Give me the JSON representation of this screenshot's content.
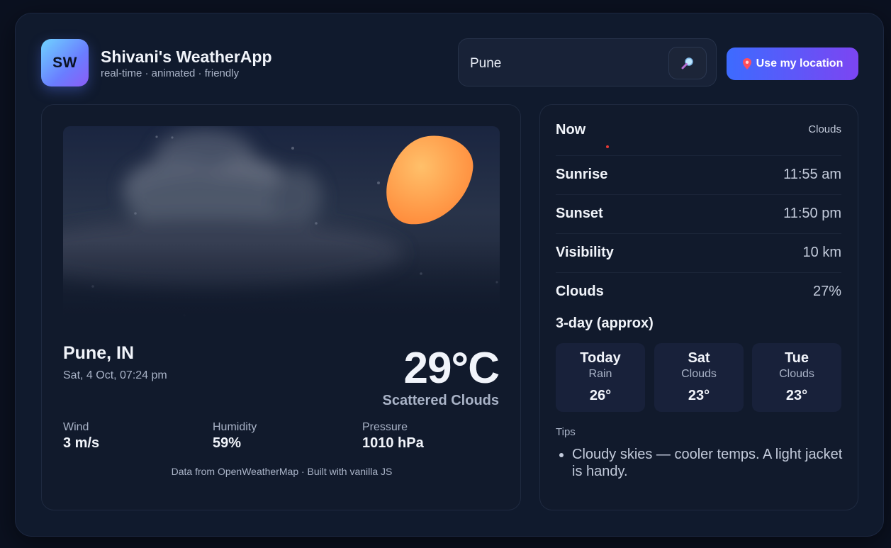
{
  "header": {
    "logo_text": "SW",
    "title": "Shivani's WeatherApp",
    "subtitle": "real-time · animated · friendly",
    "search_value": "Pune",
    "search_icon": "magnifier-icon",
    "location_icon": "pin-icon",
    "location_button": "Use my location",
    "accent_gradient": [
      "#3d6bff",
      "#7c45f2"
    ]
  },
  "current": {
    "city": "Pune, IN",
    "datetime": "Sat, 4 Oct, 07:24 pm",
    "temperature": "29°C",
    "condition": "Scattered Clouds",
    "metrics": [
      {
        "label": "Wind",
        "value": "3 m/s"
      },
      {
        "label": "Humidity",
        "value": "59%"
      },
      {
        "label": "Pressure",
        "value": "1010 hPa"
      }
    ],
    "credit": "Data from OpenWeatherMap · Built with vanilla JS"
  },
  "details": {
    "now_label": "Now",
    "now_value": "Clouds",
    "rows": [
      {
        "label": "Sunrise",
        "value": "11:55 am"
      },
      {
        "label": "Sunset",
        "value": "11:50 pm"
      },
      {
        "label": "Visibility",
        "value": "10 km"
      },
      {
        "label": "Clouds",
        "value": "27%"
      }
    ]
  },
  "forecast": {
    "title": "3-day (approx)",
    "days": [
      {
        "day": "Today",
        "condition": "Rain",
        "temp": "26°"
      },
      {
        "day": "Sat",
        "condition": "Clouds",
        "temp": "23°"
      },
      {
        "day": "Tue",
        "condition": "Clouds",
        "temp": "23°"
      }
    ]
  },
  "tips": {
    "label": "Tips",
    "items": [
      "Cloudy skies — cooler temps. A light jacket is handy."
    ]
  }
}
